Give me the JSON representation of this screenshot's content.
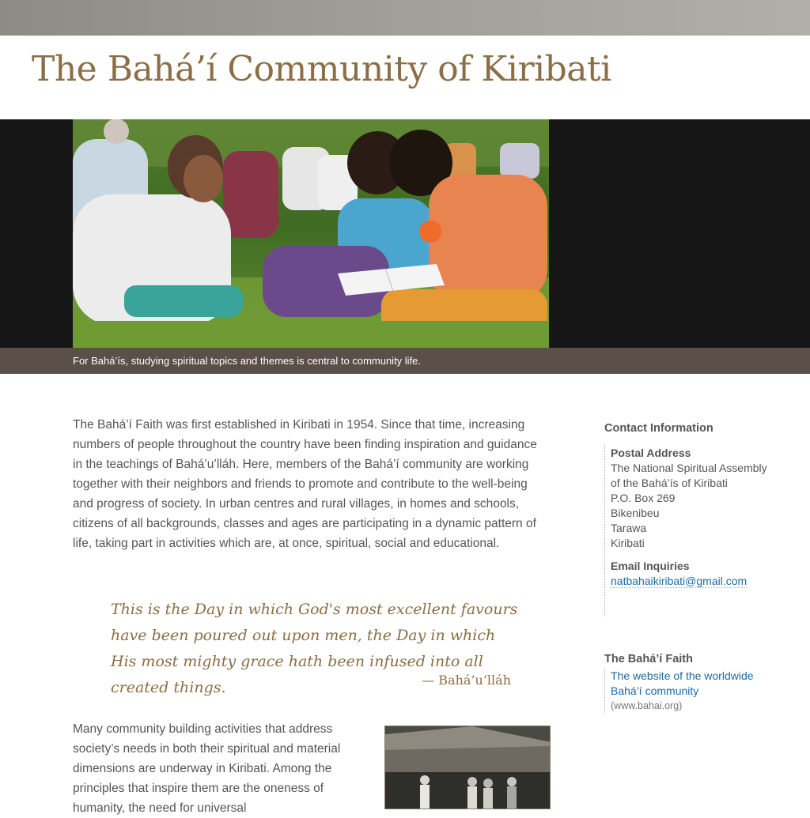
{
  "site": {
    "title": "The Bahá’í Community of Kiribati"
  },
  "hero": {
    "caption": "For Bahá’ís, studying spiritual topics and themes is central to community life."
  },
  "main": {
    "intro": "The Bahá’í Faith was first established in Kiribati in 1954. Since that time, increasing numbers of people throughout the country have been finding inspiration and guidance in the teachings of Bahá’u’lláh. Here, members of the Bahá’í community are working together with their neighbors and friends to promote and contribute to the well-being and progress of society. In urban centres and rural villages, in homes and schools, citizens of all backgrounds, classes and ages are participating in a dynamic pattern of life, taking part in activities which are, at once, spiritual, social and educational.",
    "quote": {
      "text": "This is the Day in which God's most excellent favours have been poured out upon men, the Day in which His most mighty grace hath been infused into all created things.",
      "author": "— Bahá’u’lláh"
    },
    "para2": "Many community building activities that address society’s needs in both their spiritual and material dimensions are underway in Kiribati. Among the principles that inspire them are the oneness of humanity, the need for universal"
  },
  "sidebar": {
    "contact_heading": "Contact Information",
    "postal_label": "Postal Address",
    "postal_lines": [
      "The National Spiritual Assembly",
      "of the Bahá’ís of Kiribati",
      "P.O. Box 269",
      "Bikenibeu",
      "Tarawa",
      "Kiribati"
    ],
    "email_label": "Email Inquiries",
    "email": "natbahaikiribati@gmail.com",
    "faith_heading": "The Bahá’í Faith",
    "faith_link": "The website of the worldwide Bahá’í community",
    "faith_url_text": "(www.bahai.org)"
  }
}
